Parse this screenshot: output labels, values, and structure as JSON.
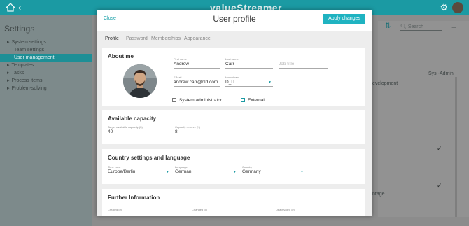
{
  "app": {
    "brand": "valueStreamer",
    "settings_title": "Settings"
  },
  "sidebar": {
    "items": [
      {
        "label": "System settings",
        "level": 0,
        "expander": "▸"
      },
      {
        "label": "Team settings",
        "level": 1
      },
      {
        "label": "User management",
        "level": 1,
        "active": true
      },
      {
        "label": "Templates",
        "level": 0,
        "expander": "▸"
      },
      {
        "label": "Tasks",
        "level": 0,
        "expander": "▸"
      },
      {
        "label": "Process items",
        "level": 0,
        "expander": "▸"
      },
      {
        "label": "Problem-solving",
        "level": 0,
        "expander": "▸"
      }
    ]
  },
  "background": {
    "search_placeholder": "Search",
    "column_sysadmin": "Sys.-Admin",
    "text_development": "evelopment",
    "text_antage": "ntage",
    "check": "✓"
  },
  "modal": {
    "close_label": "Close",
    "title": "User profile",
    "apply_label": "Apply changes",
    "tabs": [
      "Profile",
      "Password",
      "Memberships",
      "Appearance"
    ],
    "about": {
      "heading": "About me",
      "first_name_label": "First name",
      "first_name": "Andrew",
      "last_name_label": "Last name",
      "last_name": "Carr",
      "job_title_placeholder": "Job title",
      "email_label": "E-Mail",
      "email": "andrew.carr@dld.com",
      "hometeam_label": "Hometeam",
      "hometeam": "D_IT",
      "sysadmin_label": "System administrator",
      "external_label": "External"
    },
    "capacity": {
      "heading": "Available capacity",
      "target_label": "Target available capacity (h)",
      "target_value": "40",
      "reserve_label": "Capacity reserve (h)",
      "reserve_value": "8"
    },
    "country": {
      "heading": "Country settings and language",
      "timezone_label": "Time zone",
      "timezone": "Europe/Berlin",
      "language_label": "Language",
      "language": "German",
      "country_label": "Country",
      "country": "Germany"
    },
    "further": {
      "heading": "Further Information",
      "created_label": "Created on",
      "changed_label": "Changed on",
      "deactivated_label": "Deactivated on"
    }
  },
  "colors": {
    "accent": "#1b9aa3",
    "button": "#1fb3c1"
  }
}
